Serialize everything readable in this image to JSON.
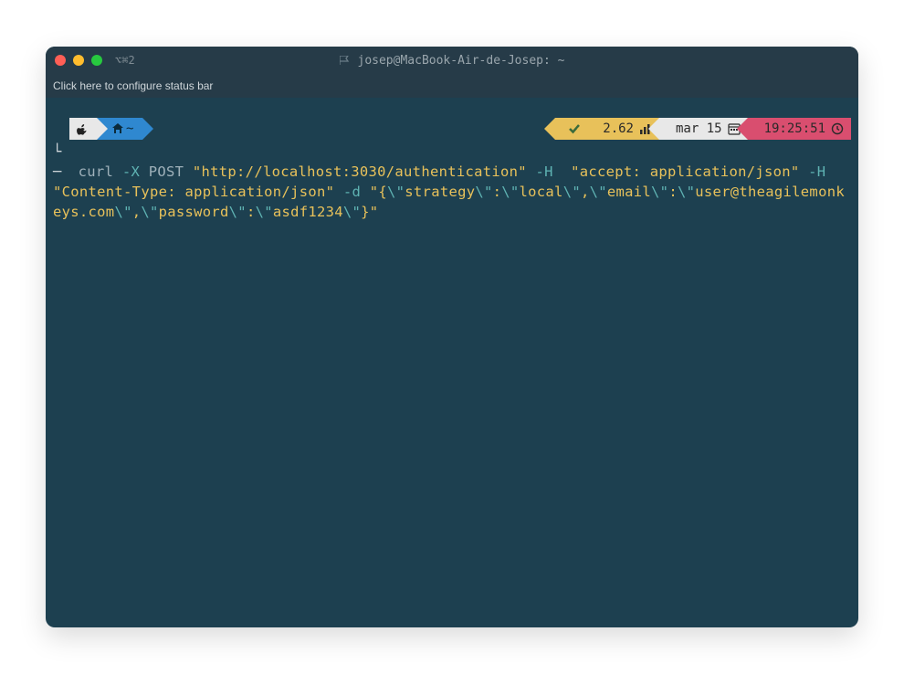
{
  "titlebar": {
    "tab_label": "⌥⌘2",
    "title": "josep@MacBook-Air-de-Josep: ~"
  },
  "statusbar": {
    "hint": "Click here to configure status bar"
  },
  "prompt": {
    "left": {
      "apple_icon": "apple-icon",
      "home_icon": "home-icon",
      "path": "~"
    },
    "right": {
      "check_icon": "check-icon",
      "load": "2.62",
      "bars_icon": "bars-icon",
      "date": "mar 15",
      "calendar_icon": "calendar-icon",
      "time": "19:25:51",
      "clock_icon": "clock-icon"
    }
  },
  "command": {
    "prefix": "└─",
    "bin": "curl",
    "flag_x": "-X",
    "method": "POST",
    "url": "\"http://localhost:3030/authentication\"",
    "flag_h1": "-H",
    "hdr1": "\"accept: application/json\"",
    "flag_h2": "-H",
    "hdr2": "\"Content-Type: application/json\"",
    "flag_d": "-d",
    "body_open": "\"{",
    "esc1": "\\\"",
    "k1": "strategy",
    "esc2": "\\\"",
    "colon1": ":",
    "esc3": "\\\"",
    "v1": "local",
    "esc4": "\\\"",
    "comma1": ",",
    "esc5": "\\\"",
    "k2": "email",
    "esc6": "\\\"",
    "colon2": ":",
    "esc7": "\\\"",
    "v2": "user@theagilemonkeys.com",
    "esc8": "\\\"",
    "comma2": ",",
    "esc9": "\\\"",
    "k3": "password",
    "esc10": "\\\"",
    "colon3": ":",
    "esc11": "\\\"",
    "v3": "asdf1234",
    "esc12": "\\\"",
    "body_close": "}\""
  }
}
